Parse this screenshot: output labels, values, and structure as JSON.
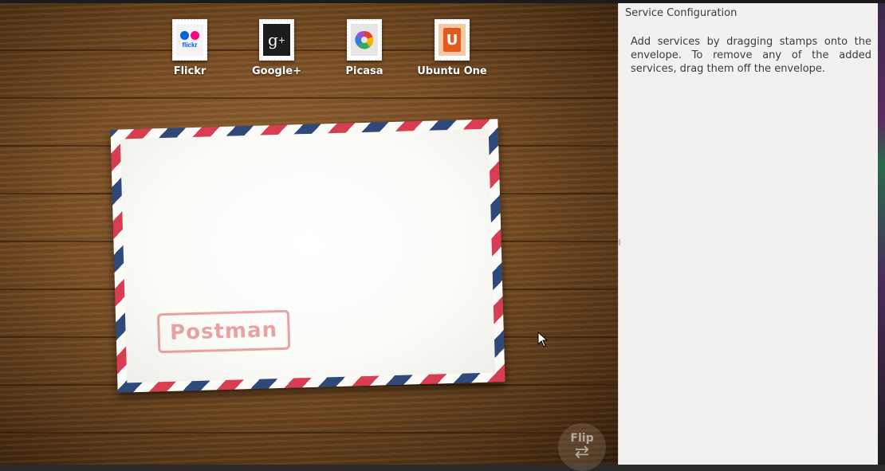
{
  "stamps": [
    {
      "label": "Flickr",
      "icon": "flickr-icon"
    },
    {
      "label": "Google+",
      "icon": "google-plus-icon"
    },
    {
      "label": "Picasa",
      "icon": "picasa-icon"
    },
    {
      "label": "Ubuntu One",
      "icon": "ubuntu-one-icon"
    }
  ],
  "envelope": {
    "postmark": "Postman"
  },
  "flip": {
    "label": "Flip",
    "icon": "flip-arrows-icon"
  },
  "panel": {
    "title": "Service Configuration",
    "description": "Add services by dragging stamps onto the envelope. To remove any of the added services, drag them off the envelope."
  },
  "colors": {
    "airmail_red": "#d83e52",
    "airmail_blue": "#2f4a78",
    "panel_bg": "#f2f1f0",
    "flickr_blue": "#0063dc",
    "flickr_pink": "#ff0084",
    "ubuntu_orange": "#e35a1c"
  }
}
